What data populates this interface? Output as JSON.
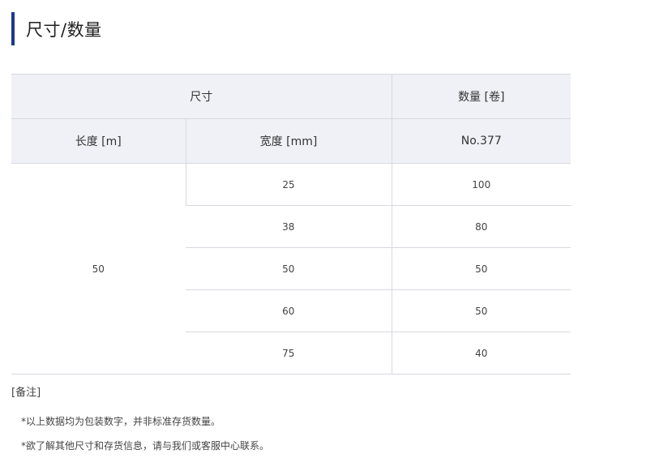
{
  "title": "尺寸/数量",
  "table": {
    "header": {
      "size_group": "尺寸",
      "quantity_group": "数量 [卷]",
      "length_label": "长度 [m]",
      "width_label": "宽度 [mm]",
      "product_label": "No.377"
    },
    "length_value": "50",
    "rows": [
      {
        "width": "25",
        "quantity": "100"
      },
      {
        "width": "38",
        "quantity": "80"
      },
      {
        "width": "50",
        "quantity": "50"
      },
      {
        "width": "60",
        "quantity": "50"
      },
      {
        "width": "75",
        "quantity": "40"
      }
    ]
  },
  "remarks": {
    "title": "[备注]",
    "notes": [
      "*以上数据均为包装数字，并非标准存货数量。",
      "*欲了解其他尺寸和存货信息，请与我们或客服中心联系。"
    ]
  }
}
